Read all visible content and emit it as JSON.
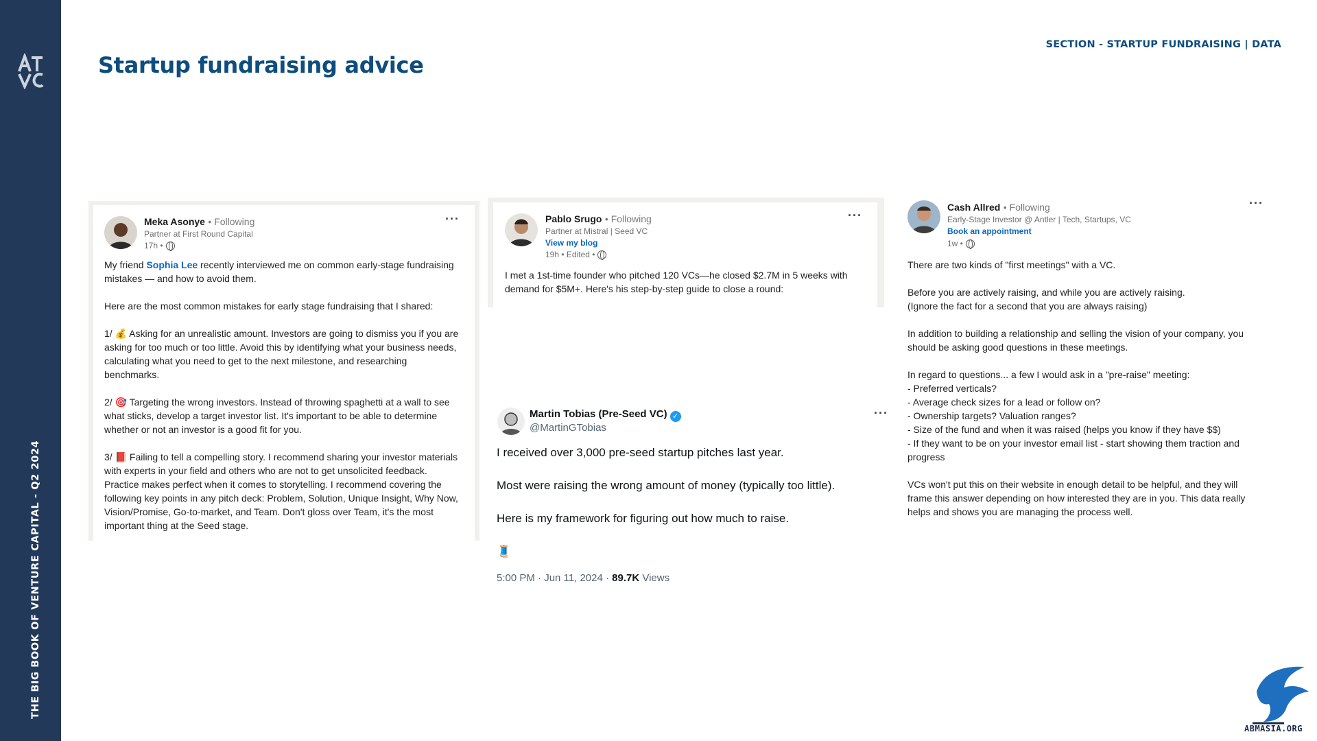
{
  "sidebar": {
    "vertical_text": "THE BIG BOOK OF VENTURE CAPITAL - Q2 2024"
  },
  "header": {
    "title": "Startup fundraising advice",
    "section": "SECTION - STARTUP FUNDRAISING | DATA"
  },
  "posts": {
    "meka": {
      "name": "Meka Asonye",
      "following": "• Following",
      "role": "Partner at First Round Capital",
      "time": "17h •",
      "intro_pre": "My friend ",
      "mention": "Sophia Lee",
      "intro_post": " recently interviewed me on common early-stage fundraising mistakes — and how to avoid them.",
      "p2": "Here are the most common mistakes for early stage fundraising that I shared:",
      "p3": "1/ 💰 Asking for an unrealistic amount. Investors are going to dismiss you if you are asking for too much or too little. Avoid this by identifying what your business needs, calculating what you need to get to the next milestone, and researching benchmarks.",
      "p4": "2/ 🎯 Targeting the wrong investors. Instead of throwing spaghetti at a wall to see what sticks, develop a target investor list. It's important to be able to determine whether or not an investor is a good fit for you.",
      "p5": "3/ 📕 Failing to tell a compelling story. I recommend sharing your investor materials with experts in your field and others who are not to get unsolicited feedback. Practice makes perfect when it comes to storytelling. I recommend covering the following key points in any pitch deck: Problem, Solution, Unique Insight, Why Now, Vision/Promise, Go-to-market, and Team. Don't gloss over Team, it's the most important thing at the Seed stage."
    },
    "pablo": {
      "name": "Pablo Srugo",
      "following": "• Following",
      "role": "Partner at Mistral | Seed VC",
      "link": "View my blog",
      "time": "19h • Edited •",
      "text": "I met a 1st-time founder who pitched 120 VCs—he closed $2.7M in 5 weeks with demand for $5M+. Here's his step-by-step guide to close a round:"
    },
    "martin": {
      "name": "Martin Tobias (Pre-Seed VC)",
      "handle": "@MartinGTobias",
      "l1": "I received over 3,000 pre-seed startup pitches last year.",
      "l2": "Most were raising the wrong amount of money (typically too little).",
      "l3": "Here is my framework for figuring out how much to raise.",
      "emoji": "🧵",
      "time": "5:00 PM · Jun 11, 2024 · ",
      "views_count": "89.7K",
      "views_label": " Views"
    },
    "cash": {
      "name": "Cash Allred",
      "following": "• Following",
      "role": "Early-Stage Investor @ Antler | Tech, Startups, VC",
      "link": "Book an appointment",
      "time": "1w •",
      "p1": "There are two kinds of \"first meetings\" with a VC.",
      "p2a": "Before you are actively raising, and while you are actively raising.",
      "p2b": "(Ignore the fact for a second that you are always raising)",
      "p3": "In addition to building a relationship and selling the vision of your company, you should be asking good questions in these meetings.",
      "p4": "In regard to questions... a few I would ask in a \"pre-raise\" meeting:",
      "b1": "- Preferred verticals?",
      "b2": "- Average check sizes for a lead or follow on?",
      "b3": "- Ownership targets? Valuation ranges?",
      "b4": "- Size of the fund and when it was raised (helps you know if they have $$)",
      "b5": "- If they want to be on your investor email list - start showing them traction and progress",
      "p5": "VCs won't put this on their website in enough detail to be helpful, and they will frame this answer depending on how interested they are in you. This data really helps and shows you are managing the process well."
    }
  },
  "dots": "···",
  "corner_logo_text": "ABMASIA.ORG"
}
